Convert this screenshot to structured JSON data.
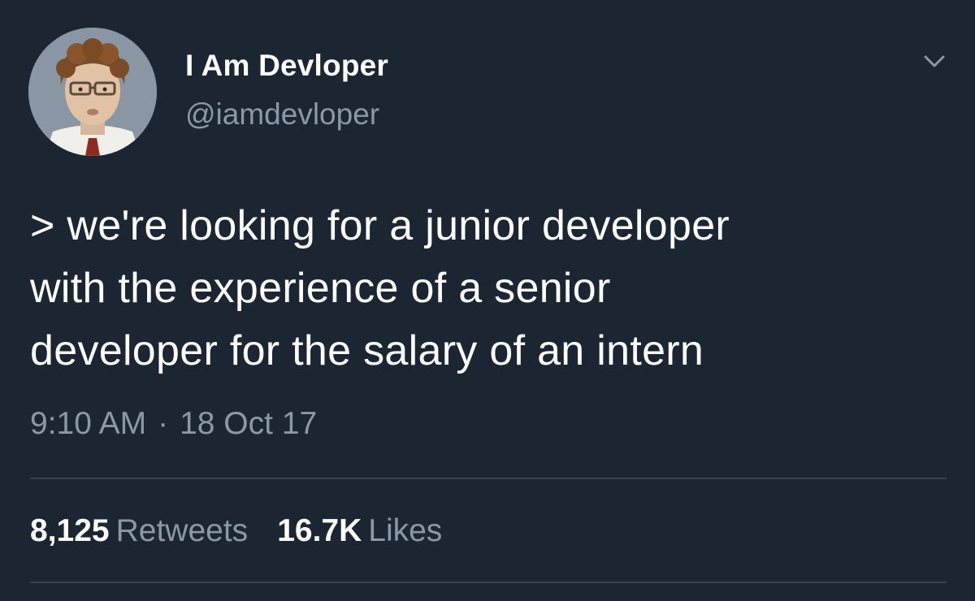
{
  "author": {
    "display_name": "I Am Devloper",
    "handle": "@iamdevloper"
  },
  "tweet": {
    "text": "> we're looking for a junior developer\nwith the experience of a senior\ndeveloper for the salary of an intern",
    "time": "9:10 AM",
    "separator": "·",
    "date": "18 Oct 17"
  },
  "stats": {
    "retweets_count": "8,125",
    "retweets_label": "Retweets",
    "likes_count": "16.7K",
    "likes_label": "Likes"
  },
  "icons": {
    "menu": "chevron-down-icon"
  },
  "colors": {
    "background": "#1c2633",
    "primary_text": "#ffffff",
    "secondary_text": "#8b98a5",
    "divider": "#38444d"
  }
}
